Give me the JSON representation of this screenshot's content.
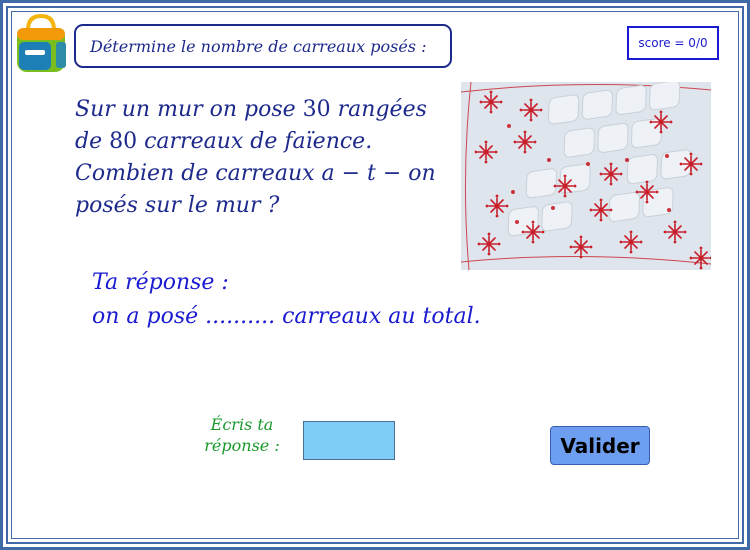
{
  "icons": {
    "backpack": "backpack-icon"
  },
  "header": {
    "instruction": "Détermine le nombre de carreaux posés :",
    "score_label": "score = 0/0"
  },
  "question": {
    "line1_a": "Sur un mur on pose ",
    "line1_num": "30",
    "line1_b": " rangées",
    "line2_a": "de ",
    "line2_num": "80",
    "line2_b": " carreaux de faïence.",
    "line3": "Combien de carreaux a − t − on",
    "line4": "posés sur le mur ?"
  },
  "answer": {
    "line1": "Ta réponse :",
    "line2": "on a posé .......... carreaux au total."
  },
  "input": {
    "label": "Écris ta réponse :",
    "value": ""
  },
  "buttons": {
    "validate": "Valider"
  },
  "colors": {
    "navy": "#1d2a8c",
    "blue": "#1a1ad0",
    "green": "#1a9a2a",
    "input_bg": "#7fcdf6",
    "button_bg": "#6d9ef0",
    "tile_red": "#c81f2a"
  }
}
